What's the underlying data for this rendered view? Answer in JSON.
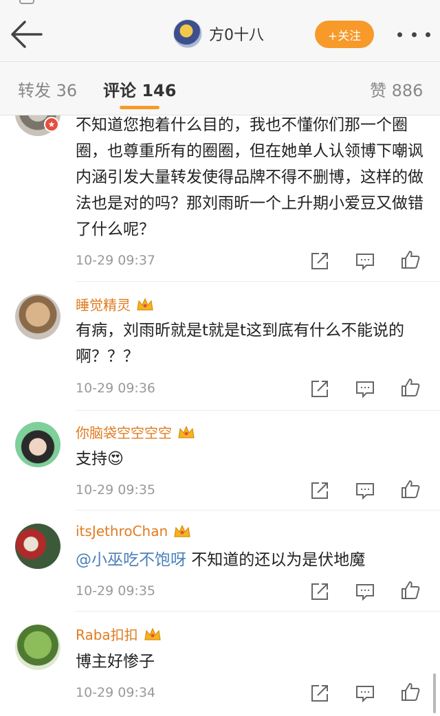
{
  "header": {
    "title": "方0十八",
    "follow_label": "+关注"
  },
  "tabs": [
    {
      "label": "转发 36"
    },
    {
      "label": "评论 146"
    },
    {
      "label": "赞 886"
    }
  ],
  "accent_color": "#f79a2a",
  "username_color": "#e07b1f",
  "mention_color": "#4a7fb8",
  "comments": [
    {
      "username": "",
      "text": "不知道您抱着什么目的，我也不懂你们那一个圈圈，也尊重所有的圈圈，但在她单人认领博下嘲讽内涵引发大量转发使得品牌不得不删博，这样的做法也是对的吗？那刘雨昕一个上升期小爱豆又做错了什么呢？",
      "time": "10-29 09:37"
    },
    {
      "username": "睡觉精灵",
      "text": "有病，刘雨昕就是t就是t这到底有什么不能说的啊？？？",
      "time": "10-29 09:36"
    },
    {
      "username": "你脑袋空空空空",
      "text": "支持",
      "emoji": "😍",
      "time": "10-29 09:35"
    },
    {
      "username": "itsJethroChan",
      "mention": "@小巫吃不饱呀",
      "text": " 不知道的还以为是伏地魔",
      "time": "10-29 09:35"
    },
    {
      "username": "Raba扣扣",
      "text": "博主好惨子",
      "time": "10-29 09:34"
    }
  ],
  "icons": [
    "back-arrow-icon",
    "more-dots-icon",
    "crown-icon",
    "share-icon",
    "comment-icon",
    "like-icon"
  ]
}
